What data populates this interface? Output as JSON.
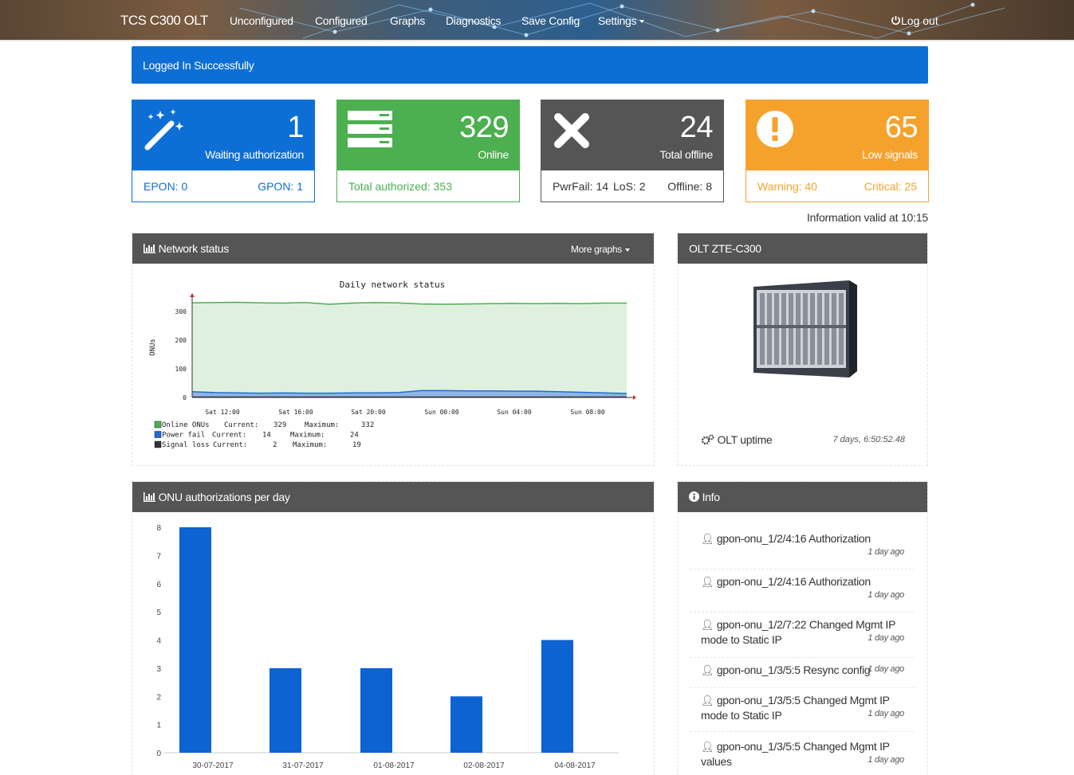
{
  "nav": {
    "brand": "TCS C300 OLT",
    "items": [
      "Unconfigured",
      "Configured",
      "Graphs",
      "Diagnostics",
      "Save Config",
      "Settings"
    ],
    "logout": "Log out"
  },
  "alert": "Logged In Successfully",
  "cards": [
    {
      "value": "1",
      "label": "Waiting authorization",
      "bottom_left": "EPON: 0",
      "bottom_right": "GPON: 1",
      "color": "#0d6fd6",
      "icon": "magic-wand-icon"
    },
    {
      "value": "329",
      "label": "Online",
      "bottom_left": "Total authorized: 353",
      "color": "#4caf50",
      "icon": "server-icon"
    },
    {
      "value": "24",
      "label": "Total offline",
      "bottom_left": "PwrFail: 14",
      "bottom_mid": "LoS: 2",
      "bottom_right": "Offline: 8",
      "color": "#555555",
      "icon": "x-icon"
    },
    {
      "value": "65",
      "label": "Low signals",
      "bottom_left": "Warning: 40",
      "bottom_right": "Critical: 25",
      "color": "#f5a22d",
      "icon": "exclamation-circle-icon"
    }
  ],
  "info_valid": "Information valid at 10:15",
  "network_panel": {
    "title": "Network status",
    "more": "More graphs"
  },
  "olt_panel": {
    "title": "OLT ZTE-C300",
    "uptime_label": "OLT uptime",
    "uptime_value": "7 days, 6:50:52.48"
  },
  "auth_panel": {
    "title": "ONU authorizations per day"
  },
  "info_panel": {
    "title": "Info",
    "items": [
      {
        "text": "gpon-onu_1/2/4:16 Authorization",
        "ago": "1 day ago"
      },
      {
        "text": "gpon-onu_1/2/4:16 Authorization",
        "ago": "1 day ago"
      },
      {
        "text": "gpon-onu_1/2/7:22 Changed Mgmt IP mode to Static IP",
        "ago": "1 day ago"
      },
      {
        "text": "gpon-onu_1/3/5:5 Resync config",
        "ago": "1 day ago"
      },
      {
        "text": "gpon-onu_1/3/5:5 Changed Mgmt IP mode to Static IP",
        "ago": "1 day ago"
      },
      {
        "text": "gpon-onu_1/3/5:5 Changed Mgmt IP values",
        "ago": "1 day ago"
      }
    ]
  },
  "chart_data": [
    {
      "type": "area",
      "title": "Daily network status",
      "ylabel": "ONUs",
      "ylim": [
        0,
        350
      ],
      "yticks": [
        0,
        100,
        200,
        300
      ],
      "xticks": [
        "Sat 12:00",
        "Sat 16:00",
        "Sat 20:00",
        "Sun 00:00",
        "Sun 04:00",
        "Sun 08:00"
      ],
      "series": [
        {
          "name": "Online ONUs",
          "color": "#4caf50",
          "values": [
            330,
            331,
            332,
            330,
            329,
            331,
            325,
            329,
            331,
            330,
            326,
            325,
            326,
            327,
            328,
            327,
            328,
            327,
            329,
            329
          ]
        },
        {
          "name": "Power fail",
          "color": "#1e6fd0",
          "values": [
            20,
            17,
            16,
            15,
            16,
            15,
            15,
            16,
            16,
            17,
            24,
            24,
            23,
            23,
            22,
            22,
            20,
            18,
            16,
            14
          ]
        },
        {
          "name": "Signal loss",
          "color": "#333333",
          "values": [
            2,
            2,
            2,
            2,
            2,
            2,
            2,
            2,
            2,
            2,
            2,
            2,
            2,
            2,
            2,
            2,
            2,
            2,
            2,
            2
          ]
        }
      ],
      "legend": [
        {
          "name": "Online ONUs",
          "current_label": "Current:",
          "current": "329",
          "max_label": "Maximum:",
          "max": "332"
        },
        {
          "name": "Power fail",
          "current_label": "Current:",
          "current": "14",
          "max_label": "Maximum:",
          "max": "24"
        },
        {
          "name": "Signal loss",
          "current_label": "Current:",
          "current": "2",
          "max_label": "Maximum:",
          "max": "19"
        }
      ],
      "grid": false
    },
    {
      "type": "bar",
      "categories": [
        "30-07-2017",
        "31-07-2017",
        "01-08-2017",
        "02-08-2017",
        "04-08-2017"
      ],
      "values": [
        8,
        3,
        3,
        2,
        4
      ],
      "ylim": [
        0,
        8
      ],
      "yticks": [
        0,
        1,
        2,
        3,
        4,
        5,
        6,
        7,
        8
      ],
      "color": "#0d63d2",
      "grid": false
    }
  ]
}
